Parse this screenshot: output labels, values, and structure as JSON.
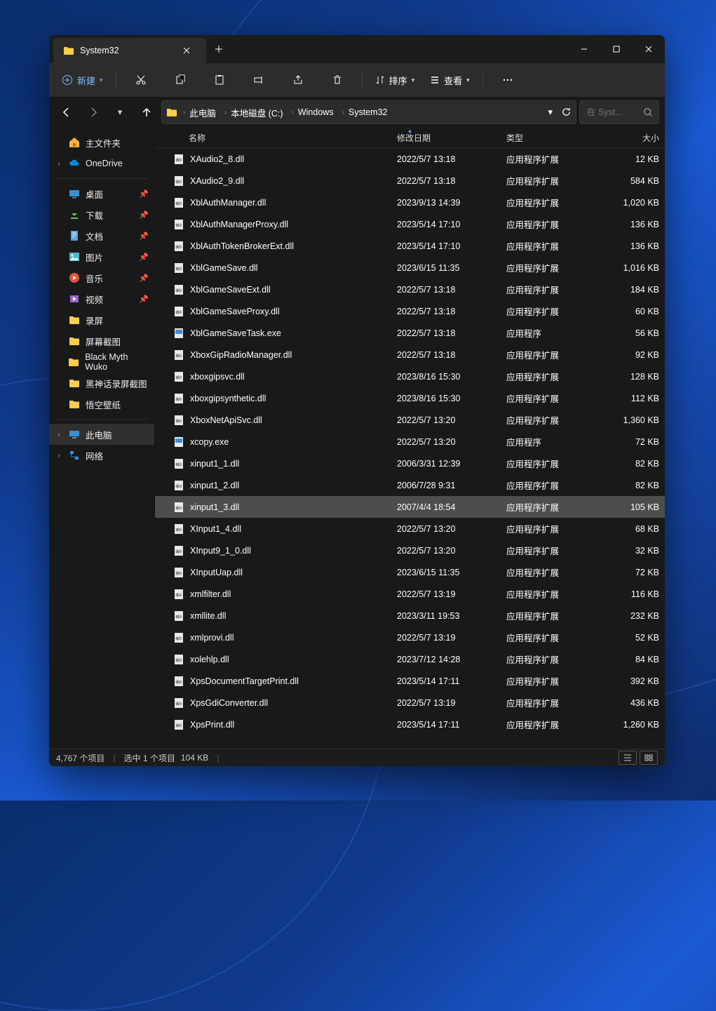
{
  "tab": {
    "title": "System32"
  },
  "toolbar": {
    "new_label": "新建",
    "sort_label": "排序",
    "view_label": "查看"
  },
  "breadcrumbs": [
    "此电脑",
    "本地磁盘 (C:)",
    "Windows",
    "System32"
  ],
  "search": {
    "placeholder": "在 Syst..."
  },
  "sidebar": {
    "home_label": "主文件夹",
    "onedrive_label": "OneDrive",
    "quick": [
      "桌面",
      "下载",
      "文档",
      "图片",
      "音乐",
      "视频",
      "录屏",
      "屏幕截图",
      "Black Myth Wuko",
      "黑神话录屏截图",
      "悟空壁纸"
    ],
    "this_pc": "此电脑",
    "network": "网络"
  },
  "columns": {
    "name": "名称",
    "date": "修改日期",
    "type": "类型",
    "size": "大小"
  },
  "files": [
    {
      "name": "XAudio2_8.dll",
      "date": "2022/5/7 13:18",
      "type": "应用程序扩展",
      "size": "12 KB",
      "ic": "dll"
    },
    {
      "name": "XAudio2_9.dll",
      "date": "2022/5/7 13:18",
      "type": "应用程序扩展",
      "size": "584 KB",
      "ic": "dll"
    },
    {
      "name": "XblAuthManager.dll",
      "date": "2023/9/13 14:39",
      "type": "应用程序扩展",
      "size": "1,020 KB",
      "ic": "dll"
    },
    {
      "name": "XblAuthManagerProxy.dll",
      "date": "2023/5/14 17:10",
      "type": "应用程序扩展",
      "size": "136 KB",
      "ic": "dll"
    },
    {
      "name": "XblAuthTokenBrokerExt.dll",
      "date": "2023/5/14 17:10",
      "type": "应用程序扩展",
      "size": "136 KB",
      "ic": "dll"
    },
    {
      "name": "XblGameSave.dll",
      "date": "2023/6/15 11:35",
      "type": "应用程序扩展",
      "size": "1,016 KB",
      "ic": "dll"
    },
    {
      "name": "XblGameSaveExt.dll",
      "date": "2022/5/7 13:18",
      "type": "应用程序扩展",
      "size": "184 KB",
      "ic": "dll"
    },
    {
      "name": "XblGameSaveProxy.dll",
      "date": "2022/5/7 13:18",
      "type": "应用程序扩展",
      "size": "60 KB",
      "ic": "dll"
    },
    {
      "name": "XblGameSaveTask.exe",
      "date": "2022/5/7 13:18",
      "type": "应用程序",
      "size": "56 KB",
      "ic": "exe"
    },
    {
      "name": "XboxGipRadioManager.dll",
      "date": "2022/5/7 13:18",
      "type": "应用程序扩展",
      "size": "92 KB",
      "ic": "dll"
    },
    {
      "name": "xboxgipsvc.dll",
      "date": "2023/8/16 15:30",
      "type": "应用程序扩展",
      "size": "128 KB",
      "ic": "dll"
    },
    {
      "name": "xboxgipsynthetic.dll",
      "date": "2023/8/16 15:30",
      "type": "应用程序扩展",
      "size": "112 KB",
      "ic": "dll"
    },
    {
      "name": "XboxNetApiSvc.dll",
      "date": "2022/5/7 13:20",
      "type": "应用程序扩展",
      "size": "1,360 KB",
      "ic": "dll"
    },
    {
      "name": "xcopy.exe",
      "date": "2022/5/7 13:20",
      "type": "应用程序",
      "size": "72 KB",
      "ic": "exe"
    },
    {
      "name": "xinput1_1.dll",
      "date": "2006/3/31 12:39",
      "type": "应用程序扩展",
      "size": "82 KB",
      "ic": "dll"
    },
    {
      "name": "xinput1_2.dll",
      "date": "2006/7/28 9:31",
      "type": "应用程序扩展",
      "size": "82 KB",
      "ic": "dll"
    },
    {
      "name": "xinput1_3.dll",
      "date": "2007/4/4 18:54",
      "type": "应用程序扩展",
      "size": "105 KB",
      "ic": "dll",
      "sel": true
    },
    {
      "name": "XInput1_4.dll",
      "date": "2022/5/7 13:20",
      "type": "应用程序扩展",
      "size": "68 KB",
      "ic": "dll"
    },
    {
      "name": "XInput9_1_0.dll",
      "date": "2022/5/7 13:20",
      "type": "应用程序扩展",
      "size": "32 KB",
      "ic": "dll"
    },
    {
      "name": "XInputUap.dll",
      "date": "2023/6/15 11:35",
      "type": "应用程序扩展",
      "size": "72 KB",
      "ic": "dll"
    },
    {
      "name": "xmlfilter.dll",
      "date": "2022/5/7 13:19",
      "type": "应用程序扩展",
      "size": "116 KB",
      "ic": "dll"
    },
    {
      "name": "xmllite.dll",
      "date": "2023/3/11 19:53",
      "type": "应用程序扩展",
      "size": "232 KB",
      "ic": "dll"
    },
    {
      "name": "xmlprovi.dll",
      "date": "2022/5/7 13:19",
      "type": "应用程序扩展",
      "size": "52 KB",
      "ic": "dll"
    },
    {
      "name": "xolehlp.dll",
      "date": "2023/7/12 14:28",
      "type": "应用程序扩展",
      "size": "84 KB",
      "ic": "dll"
    },
    {
      "name": "XpsDocumentTargetPrint.dll",
      "date": "2023/5/14 17:11",
      "type": "应用程序扩展",
      "size": "392 KB",
      "ic": "dll"
    },
    {
      "name": "XpsGdiConverter.dll",
      "date": "2022/5/7 13:19",
      "type": "应用程序扩展",
      "size": "436 KB",
      "ic": "dll"
    },
    {
      "name": "XpsPrint.dll",
      "date": "2023/5/14 17:11",
      "type": "应用程序扩展",
      "size": "1,260 KB",
      "ic": "dll"
    }
  ],
  "status": {
    "total": "4,767 个项目",
    "selected": "选中 1 个项目",
    "size": "104 KB"
  }
}
